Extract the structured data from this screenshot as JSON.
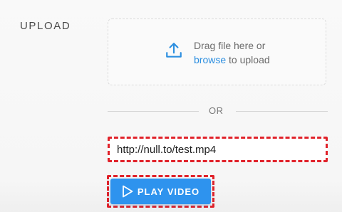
{
  "section": {
    "label": "UPLOAD"
  },
  "dropzone": {
    "line1": "Drag file here or",
    "browse": "browse",
    "line2_rest": " to upload",
    "icon": "upload-icon"
  },
  "divider": {
    "label": "OR"
  },
  "url_input": {
    "value": "http://null.to/test.mp4",
    "placeholder": ""
  },
  "play_button": {
    "label": "PLAY VIDEO",
    "icon": "play-icon"
  },
  "colors": {
    "accent": "#2e93ee",
    "link": "#2d8fe0",
    "highlight": "#e0222a"
  }
}
